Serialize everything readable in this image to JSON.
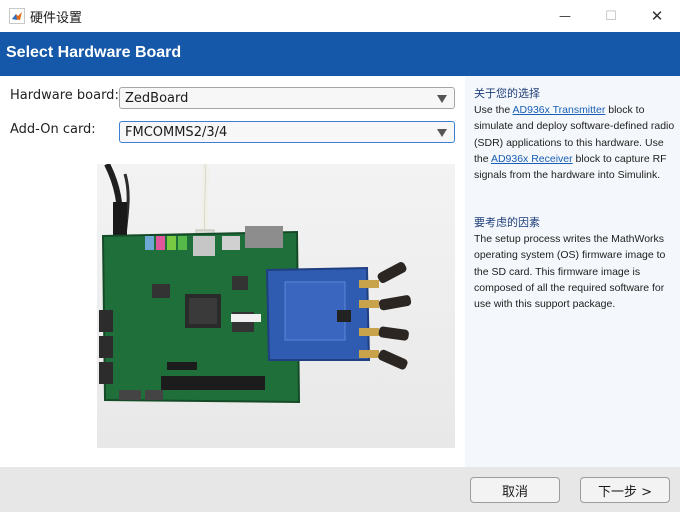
{
  "window": {
    "title": "硬件设置",
    "minimize_glyph": "—",
    "maximize_glyph": "☐",
    "close_glyph": "✕"
  },
  "header": {
    "title": "Select Hardware Board"
  },
  "form": {
    "hardware_board": {
      "label": "Hardware board:",
      "value": "ZedBoard"
    },
    "addon_card": {
      "label": "Add-On card:",
      "value": "FMCOMMS2/3/4"
    }
  },
  "info": {
    "section1_title": "关于您的选择",
    "s1_t1": "Use the ",
    "s1_link1": "AD936x Transmitter",
    "s1_t2": " block to simulate and deploy software-defined radio (SDR) applications to this hardware. Use the ",
    "s1_link2": "AD936x Receiver",
    "s1_t3": " block to capture RF signals from the hardware into Simulink.",
    "section2_title": "要考虑的因素",
    "s2_body": "The setup process writes the MathWorks operating system (OS) firmware image to the SD card. This firmware image is composed of all the required software for use with this support package."
  },
  "buttons": {
    "cancel": "取消",
    "next": "下一步 >"
  },
  "icons": {
    "app": "matlab-logo-icon",
    "dropdown": "triangle-down-icon"
  }
}
